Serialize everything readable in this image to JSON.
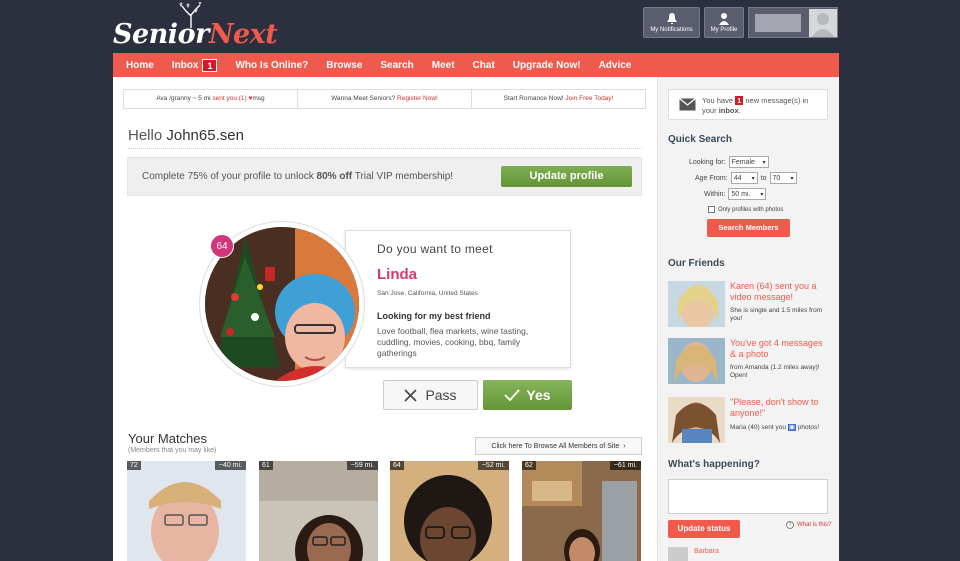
{
  "brand": {
    "part1": "Senior",
    "part2": "Next",
    "accent": "#ee5b4d"
  },
  "header": {
    "notifications_label": "My Notifications",
    "profile_label": "My Profile"
  },
  "nav": {
    "items": [
      "Home",
      "Inbox",
      "Who Is Online?",
      "Browse",
      "Search",
      "Meet",
      "Chat",
      "Upgrade Now!",
      "Advice"
    ],
    "inbox_count": "1"
  },
  "ticker": {
    "item1_prefix": "Ava /granny ~ 5 mi ",
    "item1_red": "sent you (1) ",
    "item1_suffix": "msg",
    "item2_prefix": "Wanna Meet Seniors? ",
    "item2_link": "Register Now!",
    "item3_prefix": "Start Romance Now! ",
    "item3_link": "Join Free Today!"
  },
  "greeting": {
    "hello": "Hello",
    "username": "John65.sen"
  },
  "promo": {
    "text_before": "Complete 75% of your profile to unlock ",
    "text_bold": "80% off",
    "text_after": " Trial VIP membership!",
    "button": "Update profile"
  },
  "meet": {
    "question": "Do you want to meet",
    "name": "Linda",
    "age": "64",
    "location": "San Jose, California, United States",
    "looking_for": "Looking for my best friend",
    "interests": "Love football, flea markets, wine tasting, cuddling, movies, cooking, bbq, family gatherings",
    "pass_label": "Pass",
    "yes_label": "Yes"
  },
  "matches": {
    "title": "Your Matches",
    "subtitle": "(Members that you may like)",
    "browse_all": "Click here To Browse All Members of Site",
    "items": [
      {
        "age": "72",
        "distance": "~40 mi."
      },
      {
        "age": "61",
        "distance": "~59 mi."
      },
      {
        "age": "64",
        "distance": "~52 mi."
      },
      {
        "age": "62",
        "distance": "~61 mi."
      }
    ]
  },
  "sidebar": {
    "inbox_msg": {
      "before": "You have ",
      "count": "1",
      "after": " new message(s) in your ",
      "bold": "inbox",
      "end": "."
    },
    "quick_search": {
      "title": "Quick Search",
      "looking_for_label": "Looking for:",
      "looking_for_value": "Female",
      "age_from_label": "Age From:",
      "age_from": "44",
      "to_label": "to",
      "age_to": "70",
      "within_label": "Within:",
      "within_value": "50 mi.",
      "photos_only_label": "Only profiles with photos",
      "button": "Search Members"
    },
    "friends": {
      "title": "Our Friends",
      "items": [
        {
          "title": "Karen (64) sent you a video message!",
          "sub": "She is single and 1.5 miles from you!"
        },
        {
          "title": "You've got 4 messages & a photo",
          "sub": "from Amanda (1.2 miles away)! Open!"
        },
        {
          "title": "\"Please, don't show to anyone!\"",
          "sub_before": "Maria (40) sent you ",
          "sub_after": " photos!"
        }
      ]
    },
    "happening": {
      "title": "What's happening?",
      "update_button": "Update status",
      "what_is_this": "What is this?",
      "recent_name": "Barbara"
    }
  }
}
